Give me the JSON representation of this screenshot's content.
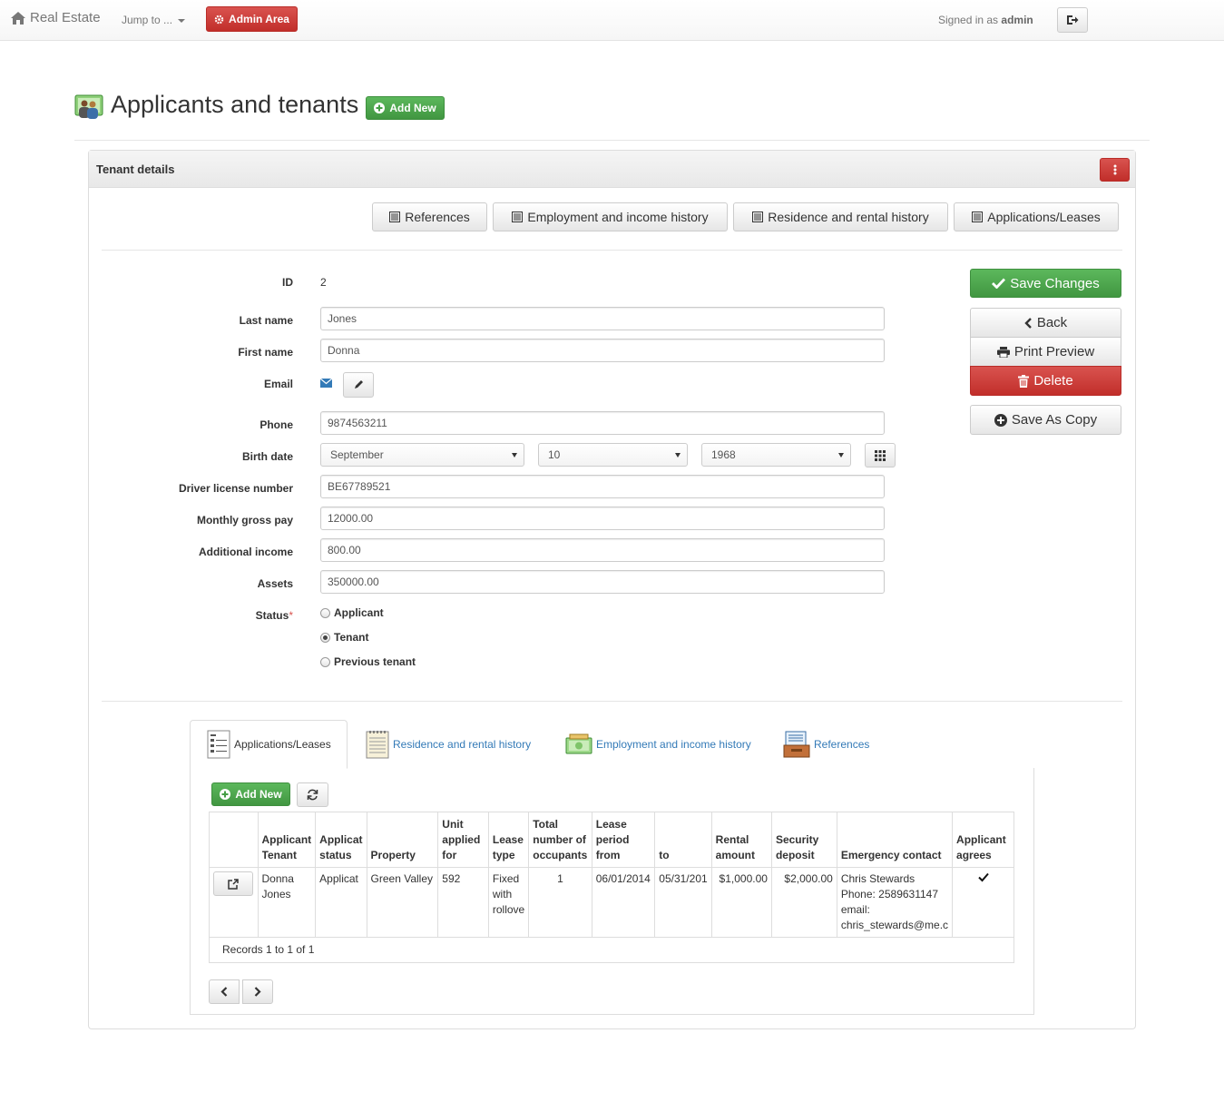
{
  "navbar": {
    "brand": "Real Estate",
    "jump_to": "Jump to ...",
    "admin_area": "Admin Area",
    "signed_in_prefix": "Signed in as",
    "signed_in_user": "admin"
  },
  "page": {
    "title": "Applicants and tenants",
    "add_new": "Add New"
  },
  "panel": {
    "title": "Tenant details",
    "link_buttons": [
      "References",
      "Employment and income history",
      "Residence and rental history",
      "Applications/Leases"
    ]
  },
  "form": {
    "labels": {
      "id": "ID",
      "last_name": "Last name",
      "first_name": "First name",
      "email": "Email",
      "phone": "Phone",
      "birth_date": "Birth date",
      "driver_license": "Driver license number",
      "monthly_gross_pay": "Monthly gross pay",
      "additional_income": "Additional income",
      "assets": "Assets",
      "status": "Status"
    },
    "required_mark": "*",
    "values": {
      "id": "2",
      "last_name": "Jones",
      "first_name": "Donna",
      "phone": "9874563211",
      "birth_month": "September",
      "birth_day": "10",
      "birth_year": "1968",
      "driver_license": "BE67789521",
      "monthly_gross_pay": "12000.00",
      "additional_income": "800.00",
      "assets": "350000.00"
    },
    "status_options": [
      "Applicant",
      "Tenant",
      "Previous tenant"
    ],
    "status_selected": "Tenant"
  },
  "actions": {
    "save_changes": "Save Changes",
    "back": "Back",
    "print_preview": "Print Preview",
    "delete": "Delete",
    "save_as_copy": "Save As Copy"
  },
  "tabs": [
    "Applications/Leases",
    "Residence and rental history",
    "Employment and income history",
    "References"
  ],
  "subtable": {
    "add_new": "Add New",
    "headers": {
      "tenant_l1": "Applicant",
      "tenant_l2": "Tenant",
      "status_l1": "Applicat",
      "status_l2": "status",
      "property": "Property",
      "unit_l1": "Unit",
      "unit_l2": "applied",
      "unit_l3": "for",
      "lease_l1": "Lease",
      "lease_l2": "type",
      "occ_l1": "Total",
      "occ_l2": "number of",
      "occ_l3": "occupants",
      "from_l1": "Lease",
      "from_l2": "period",
      "from_l3": "from",
      "to": "to",
      "rent_l1": "Rental",
      "rent_l2": "amount",
      "deposit_l1": "Security",
      "deposit_l2": "deposit",
      "emergency": "Emergency contact",
      "agrees_l1": "Applicant",
      "agrees_l2": "agrees"
    },
    "row": {
      "tenant_l1": "Donna",
      "tenant_l2": "Jones",
      "status": "Applicat",
      "property": "Green Valley",
      "unit": "592",
      "lease_l1": "Fixed",
      "lease_l2": "with",
      "lease_l3": "rollove",
      "occupants": "1",
      "from": "06/01/2014",
      "to": "05/31/201",
      "rent": "$1,000.00",
      "deposit": "$2,000.00",
      "emergency_l1": "Chris Stewards",
      "emergency_l2": "Phone: 2589631147",
      "emergency_l3": "email:",
      "emergency_l4": "chris_stewards@me.c",
      "agrees": true
    },
    "records": "Records 1 to 1 of 1"
  },
  "colors": {
    "green": "#5cb85c",
    "red": "#d9534f",
    "link": "#337ab7"
  }
}
